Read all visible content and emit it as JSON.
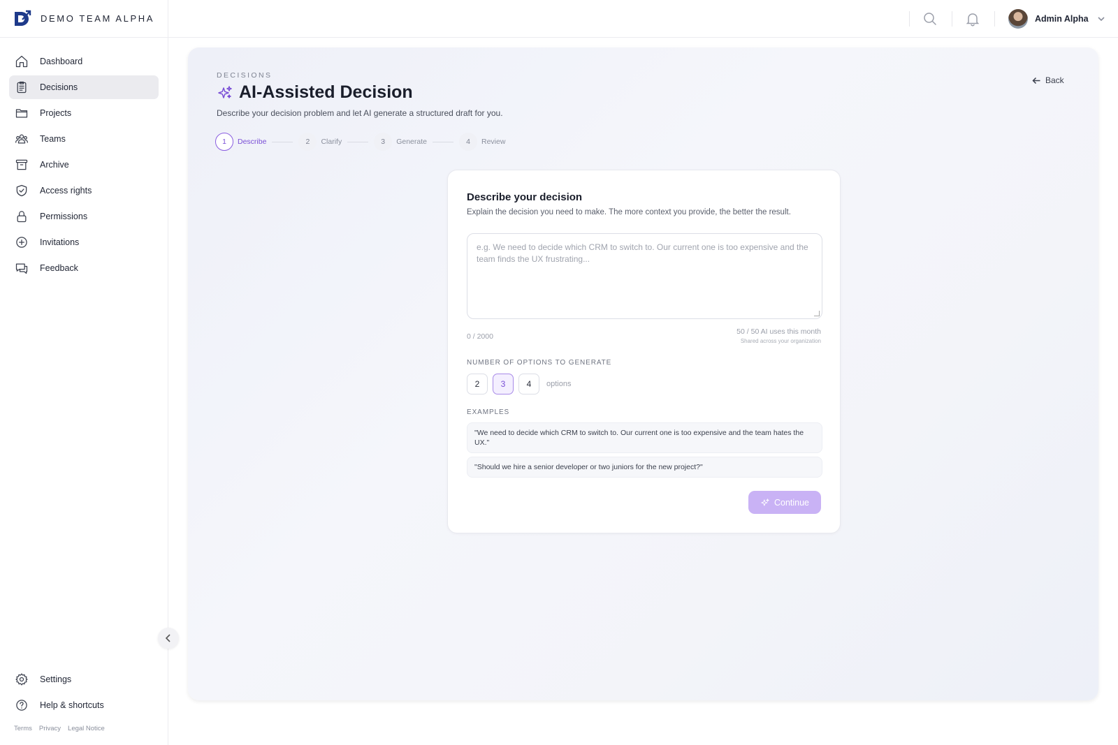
{
  "brand": {
    "name": "DEMO TEAM ALPHA",
    "logo_color": "#1e3a8a"
  },
  "sidebar": {
    "items": [
      {
        "label": "Dashboard",
        "icon": "home-icon"
      },
      {
        "label": "Decisions",
        "icon": "clipboard-icon",
        "active": true
      },
      {
        "label": "Projects",
        "icon": "folder-icon"
      },
      {
        "label": "Teams",
        "icon": "users-icon"
      },
      {
        "label": "Archive",
        "icon": "archive-icon"
      },
      {
        "label": "Access rights",
        "icon": "shield-icon"
      },
      {
        "label": "Permissions",
        "icon": "lock-icon"
      },
      {
        "label": "Invitations",
        "icon": "plus-circle-icon"
      },
      {
        "label": "Feedback",
        "icon": "chat-icon"
      }
    ],
    "bottom_items": [
      {
        "label": "Settings",
        "icon": "gear-icon"
      },
      {
        "label": "Help & shortcuts",
        "icon": "help-icon"
      }
    ],
    "footer_links": [
      "Terms",
      "Privacy",
      "Legal Notice"
    ]
  },
  "topbar": {
    "user_name": "Admin Alpha"
  },
  "page": {
    "eyebrow": "DECISIONS",
    "title": "AI-Assisted Decision",
    "subtitle": "Describe your decision problem and let AI generate a structured draft for you.",
    "back_label": "Back",
    "accent_color": "#7a4fd6"
  },
  "stepper": [
    {
      "num": "1",
      "label": "Describe",
      "active": true
    },
    {
      "num": "2",
      "label": "Clarify"
    },
    {
      "num": "3",
      "label": "Generate"
    },
    {
      "num": "4",
      "label": "Review"
    }
  ],
  "card": {
    "title": "Describe your decision",
    "description": "Explain the decision you need to make. The more context you provide, the better the result.",
    "textarea_placeholder": "e.g. We need to decide which CRM to switch to. Our current one is too expensive and the team finds the UX frustrating...",
    "char_count": "0 / 2000",
    "usage_main": "50 / 50 AI uses this month",
    "usage_sub": "Shared across your organization",
    "options_label": "NUMBER OF OPTIONS TO GENERATE",
    "options": [
      "2",
      "3",
      "4"
    ],
    "selected_option": "3",
    "options_suffix": "options",
    "examples_label": "EXAMPLES",
    "examples": [
      "\"We need to decide which CRM to switch to. Our current one is too expensive and the team hates the UX.\"",
      "\"Should we hire a senior developer or two juniors for the new project?\""
    ],
    "continue_label": "Continue"
  }
}
